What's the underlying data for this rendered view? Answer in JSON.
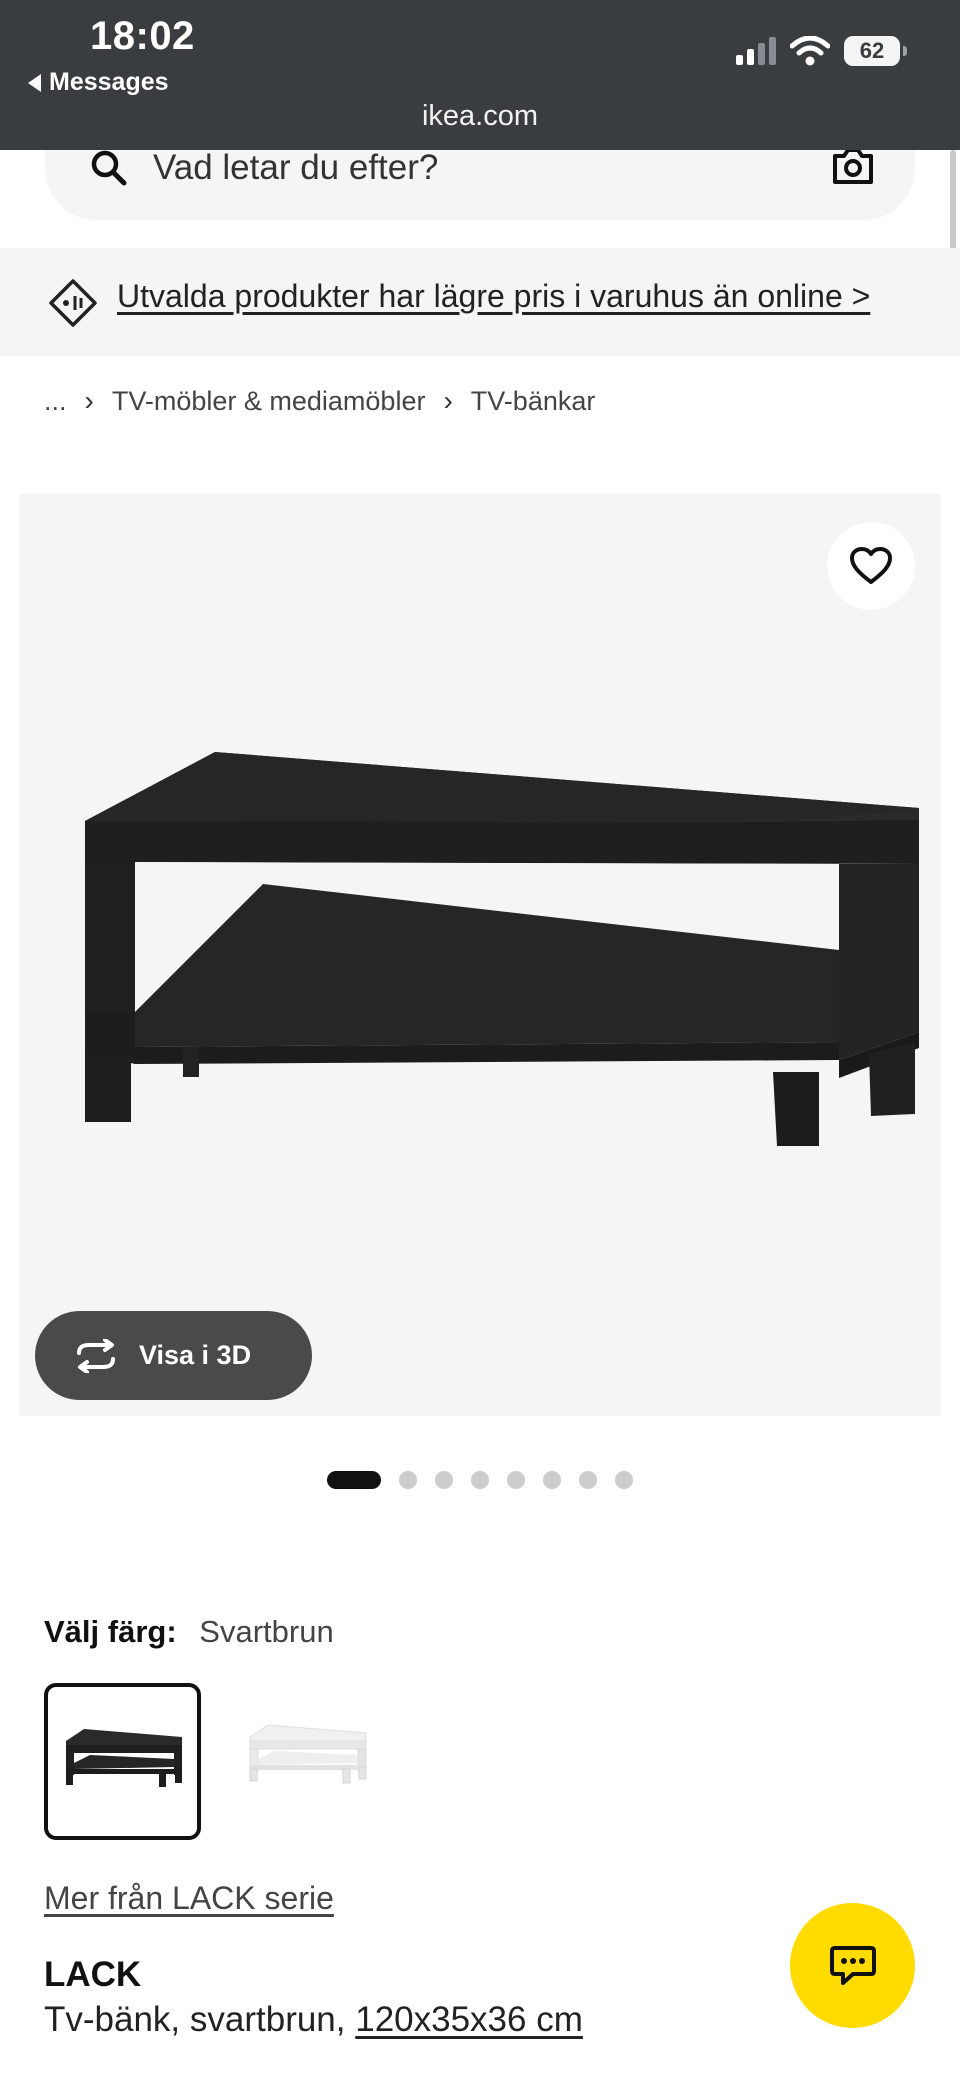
{
  "status_bar": {
    "time": "18:02",
    "back_label": "Messages",
    "battery": "62",
    "url": "ikea.com"
  },
  "search": {
    "placeholder": "Vad letar du efter?"
  },
  "promo": {
    "text": "Utvalda produkter har lägre pris i varuhus än online >"
  },
  "breadcrumb": {
    "items": [
      "...",
      "TV-möbler & mediamöbler",
      "TV-bänkar"
    ]
  },
  "gallery": {
    "view_3d_label": "Visa i 3D",
    "total_images": 8,
    "active_image": 1
  },
  "color": {
    "label": "Välj färg:",
    "selected": "Svartbrun"
  },
  "series_link": "Mer från LACK serie",
  "product": {
    "name": "LACK",
    "description_prefix": "Tv-bänk, svartbrun,",
    "dimensions": "120x35x36 cm"
  },
  "colors": {
    "status_bar": "#393d40",
    "chat_button": "#ffdb00",
    "background_light": "#f5f5f5"
  },
  "icons": {
    "search": "search-icon",
    "camera": "camera-icon",
    "promo": "price-tag-icon",
    "favorite": "heart-icon",
    "view3d": "rotate-3d-icon",
    "chat": "chat-icon"
  }
}
